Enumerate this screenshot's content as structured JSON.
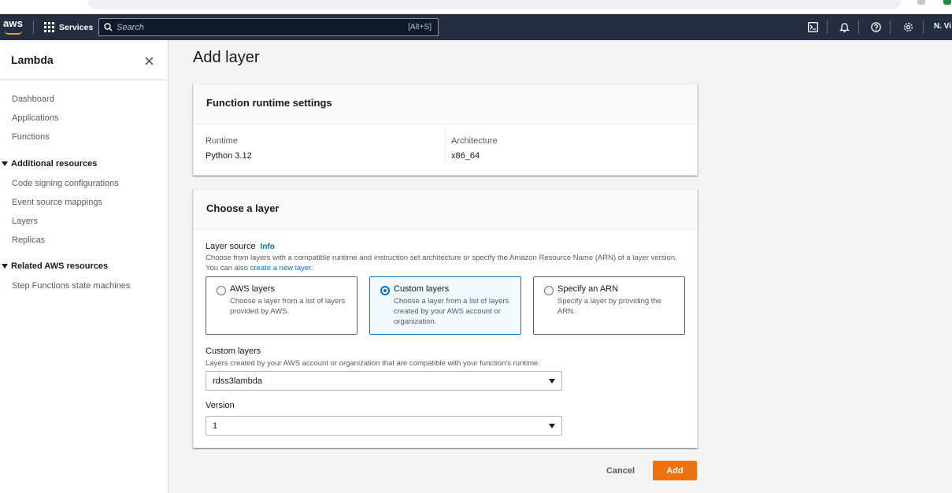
{
  "topnav": {
    "logo_text": "aws",
    "services_label": "Services",
    "search_placeholder": "Search",
    "search_shortcut": "[Alt+S]",
    "account_label": "N. Vi",
    "icons": [
      "cloudshell-icon",
      "bell-icon",
      "help-icon",
      "gear-icon"
    ]
  },
  "sidebar": {
    "title": "Lambda",
    "items": [
      "Dashboard",
      "Applications",
      "Functions"
    ],
    "section_additional": "Additional resources",
    "additional_items": [
      "Code signing configurations",
      "Event source mappings",
      "Layers",
      "Replicas"
    ],
    "section_related": "Related AWS resources",
    "related_items": [
      "Step Functions state machines"
    ]
  },
  "page": {
    "title": "Add layer"
  },
  "runtime_panel": {
    "title": "Function runtime settings",
    "runtime_label": "Runtime",
    "runtime_value": "Python 3.12",
    "arch_label": "Architecture",
    "arch_value": "x86_64"
  },
  "layer_panel": {
    "title": "Choose a layer",
    "source_label": "Layer source",
    "info_link": "Info",
    "source_desc": "Choose from layers with a compatible runtime and instruction set architecture or specify the Amazon Resource Name (ARN) of a layer version. You can also",
    "source_desc_link": "create a new layer.",
    "tiles": [
      {
        "title": "AWS layers",
        "desc": "Choose a layer from a list of layers provided by AWS.",
        "selected": false
      },
      {
        "title": "Custom layers",
        "desc": "Choose a layer from a list of layers created by your AWS account or organization.",
        "selected": true
      },
      {
        "title": "Specify an ARN",
        "desc": "Specify a layer by providing the ARN.",
        "selected": false
      }
    ],
    "custom_label": "Custom layers",
    "custom_desc": "Layers created by your AWS account or organization that are compatible with your function's runtime.",
    "custom_value": "rdss3lambda",
    "version_label": "Version",
    "version_value": "1"
  },
  "actions": {
    "cancel": "Cancel",
    "add": "Add"
  },
  "colors": {
    "nav_bg": "#232f3e",
    "accent_orange": "#ec7211",
    "link_blue": "#0073bb",
    "selected_bg": "#f1faff"
  }
}
